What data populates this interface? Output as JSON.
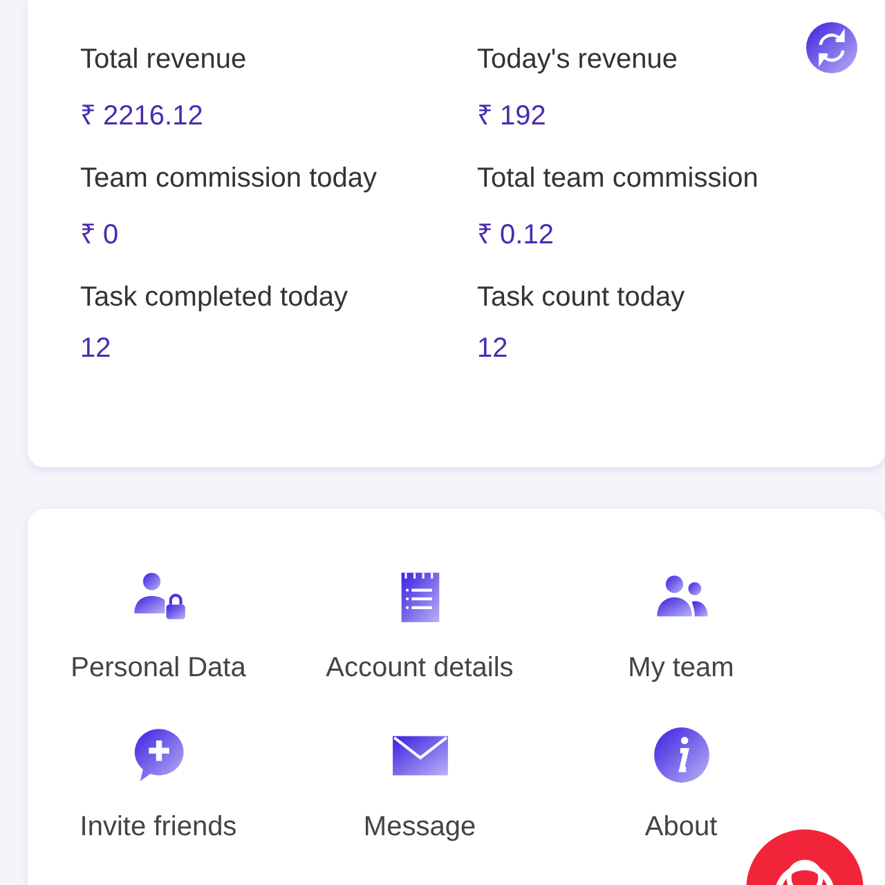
{
  "stats": [
    {
      "label": "Total revenue",
      "value": "₹ 2216.12"
    },
    {
      "label": "Today's revenue",
      "value": "₹ 192"
    },
    {
      "label": "Team commission today",
      "value": "₹ 0"
    },
    {
      "label": "Total team commission",
      "value": "₹ 0.12"
    },
    {
      "label": "Task completed today",
      "value": "12"
    },
    {
      "label": "Task count today",
      "value": "12"
    }
  ],
  "menu": [
    {
      "label": "Personal Data",
      "kind": "user-lock"
    },
    {
      "label": "Account details",
      "kind": "notepad"
    },
    {
      "label": "My team",
      "kind": "team"
    },
    {
      "label": "Invite friends",
      "kind": "chat-plus"
    },
    {
      "label": "Message",
      "kind": "envelope"
    },
    {
      "label": "About",
      "kind": "info"
    }
  ]
}
